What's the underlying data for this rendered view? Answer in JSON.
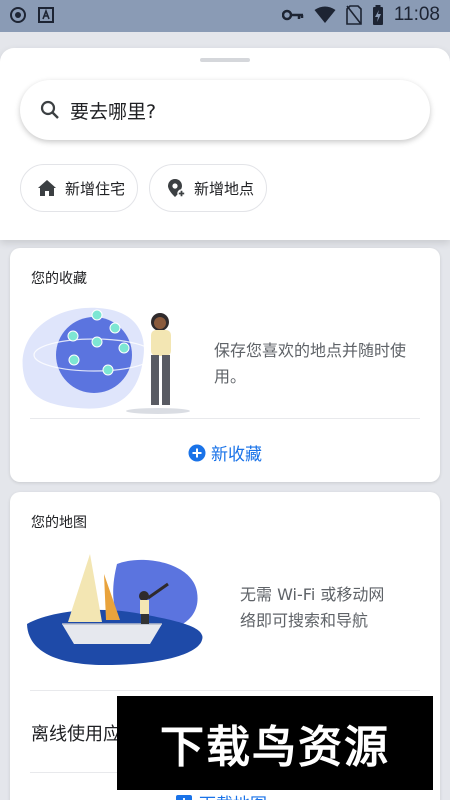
{
  "status_bar": {
    "time": "11:08",
    "left_icons": [
      "shield-icon",
      "a-box-icon"
    ],
    "right_icons": [
      "vpn-key-icon",
      "wifi-icon",
      "no-sim-icon",
      "battery-charging-icon"
    ]
  },
  "search": {
    "placeholder": "要去哪里?"
  },
  "chips": [
    {
      "label": "新增住宅",
      "icon": "home-icon"
    },
    {
      "label": "新增地点",
      "icon": "add-location-icon"
    }
  ],
  "favorites_card": {
    "title": "您的收藏",
    "description_line1": "保存您喜欢的地点并随时使",
    "description_line2": "用。",
    "action_label": "新收藏",
    "action_icon": "add-circle-icon"
  },
  "maps_card": {
    "title": "您的地图",
    "description_line1": "无需 Wi-Fi 或移动网",
    "description_line2": "络即可搜索和导航",
    "offline_label": "离线使用应",
    "action_label": "下载地图",
    "action_icon": "download-map-icon"
  },
  "watermark": "下载鸟资源",
  "colors": {
    "accent": "#1a73e8",
    "status_bar": "#8a9bb5",
    "background": "#e4e6eb"
  }
}
